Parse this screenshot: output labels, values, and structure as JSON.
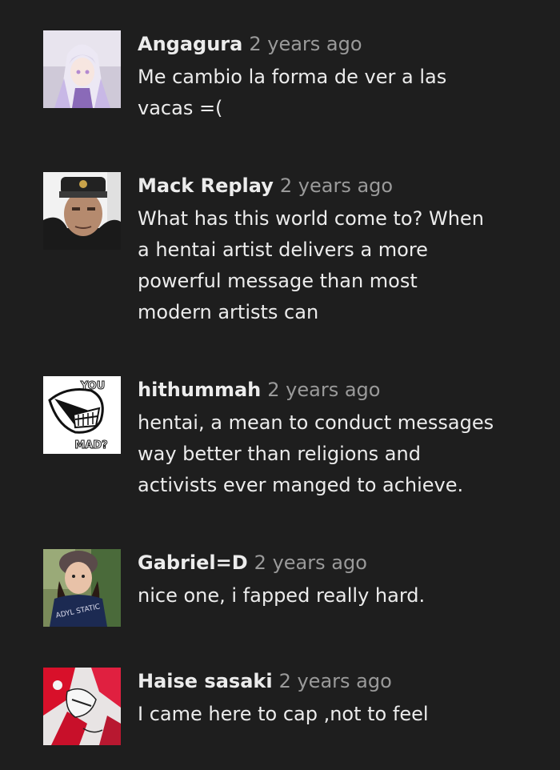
{
  "comments": [
    {
      "author": "Angagura",
      "time": "2 years ago",
      "text_lines": [
        "Me cambio la forma de ver a las",
        "vacas =("
      ],
      "avatar": "anime-girl-avatar"
    },
    {
      "author": "Mack Replay",
      "time": "2 years ago",
      "text_lines": [
        "What has this world come to? When",
        "a hentai artist delivers a more",
        "powerful message than most",
        "modern artists can"
      ],
      "avatar": "military-officer-avatar"
    },
    {
      "author": "hithummah",
      "time": "2 years ago",
      "text_lines": [
        "hentai, a mean to conduct messages",
        "way better than religions and",
        "activists ever manged to achieve."
      ],
      "avatar": "you-mad-meme-avatar",
      "avatar_text": {
        "top": "YOU",
        "bottom": "MAD?"
      }
    },
    {
      "author": "Gabriel=D",
      "time": "2 years ago",
      "text_lines": [
        "nice one, i fapped really hard."
      ],
      "avatar": "child-photo-avatar",
      "avatar_text": {
        "shirt": "ADYL STATIC"
      }
    },
    {
      "author": "Haise sasaki",
      "time": "2 years ago",
      "text_lines": [
        "I came here to cap ,not to feel"
      ],
      "avatar": "red-abstract-art-avatar"
    }
  ],
  "colors": {
    "background": "#1e1e1e",
    "author": "#ececec",
    "timestamp": "#9a9a9a",
    "text": "#ececec"
  }
}
